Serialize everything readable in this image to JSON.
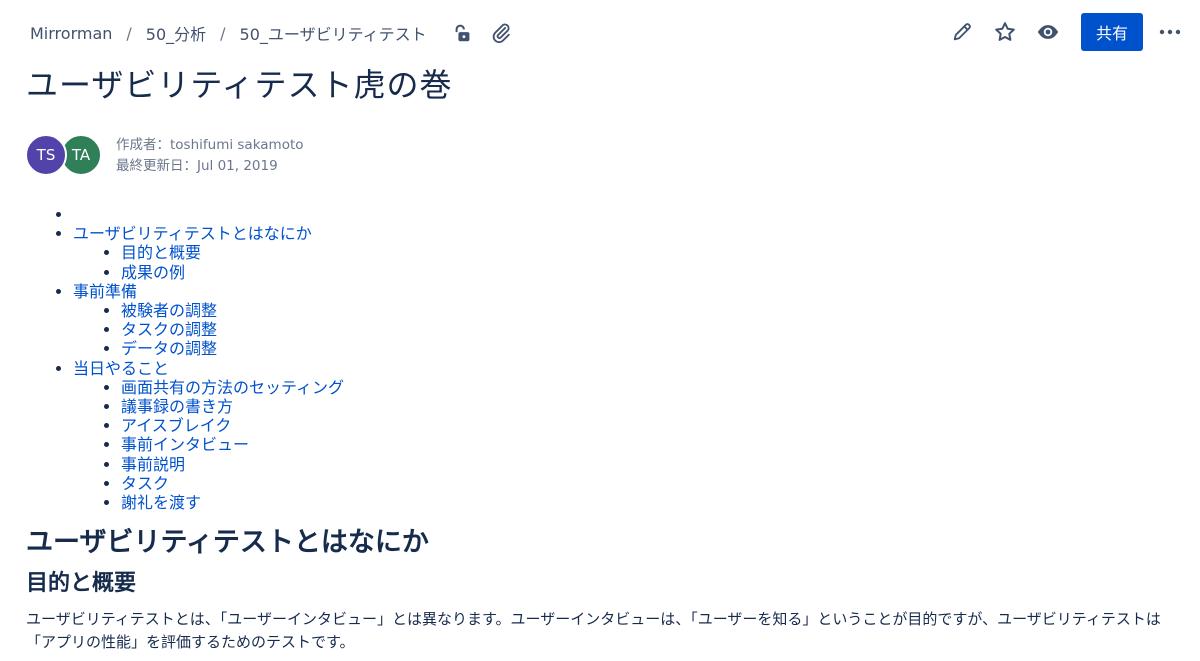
{
  "breadcrumb": {
    "items": [
      "Mirrorman",
      "50_分析",
      "50_ユーザビリティテスト"
    ],
    "separator": "/"
  },
  "header_icons": {
    "restrictions": "unlock-icon",
    "attachments": "paperclip-icon",
    "edit": "pencil-icon",
    "star": "star-icon",
    "watch": "eye-icon",
    "more": "more-icon"
  },
  "share_label": "共有",
  "accent_color": "#0052cc",
  "page": {
    "title": "ユーザビリティテスト虎の巻",
    "avatars": [
      {
        "initials": "TS",
        "color": "#5243aa"
      },
      {
        "initials": "TA",
        "color": "#2f7f58"
      }
    ],
    "author_line": "作成者：toshifumi sakamoto",
    "updated_line": "最終更新日：Jul 01, 2019"
  },
  "toc": [
    {
      "label": "",
      "children": []
    },
    {
      "label": "ユーザビリティテストとはなにか",
      "children": [
        "目的と概要",
        "成果の例"
      ]
    },
    {
      "label": "事前準備",
      "children": [
        "被験者の調整",
        "タスクの調整",
        "データの調整"
      ]
    },
    {
      "label": "当日やること",
      "children": [
        "画面共有の方法のセッティング",
        "議事録の書き方",
        "アイスブレイク",
        "事前インタビュー",
        "事前説明",
        "タスク",
        "謝礼を渡す"
      ]
    }
  ],
  "content": {
    "h2": "ユーザビリティテストとはなにか",
    "h3": "目的と概要",
    "paragraph": "ユーザビリティテストとは、「ユーザーインタビュー」とは異なります。ユーザーインタビューは、「ユーザーを知る」ということが目的ですが、ユーザビリティテストは「アプリの性能」を評価するためのテストです。"
  }
}
